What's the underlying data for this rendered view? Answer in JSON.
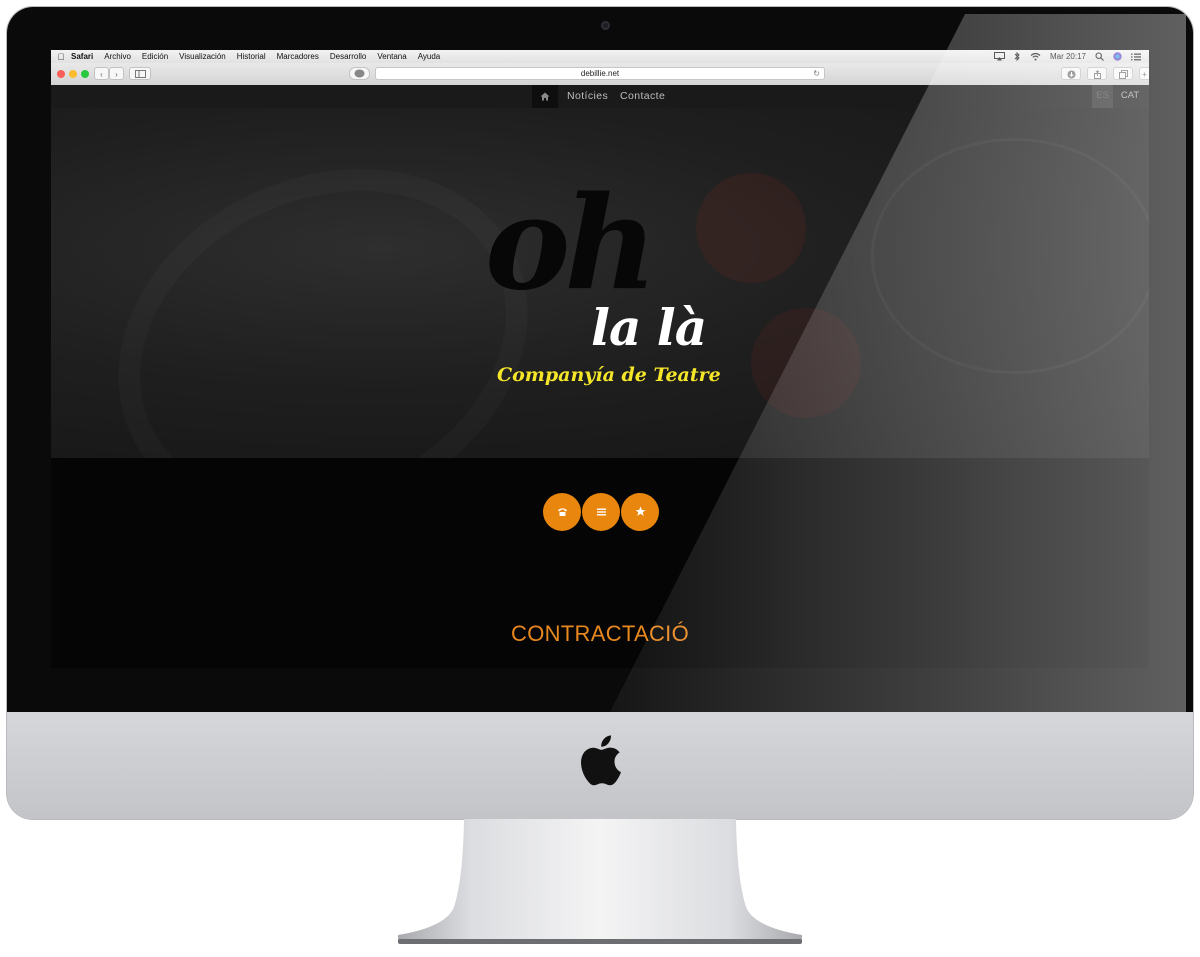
{
  "menubar": {
    "apple_icon": "apple-icon",
    "items": [
      "Safari",
      "Archivo",
      "Edición",
      "Visualización",
      "Historial",
      "Marcadores",
      "Desarrollo",
      "Ventana",
      "Ayuda"
    ],
    "clock": "Mar 20:17"
  },
  "browser": {
    "url": "debillie.net"
  },
  "site_nav": {
    "links": [
      "Notícies",
      "Contacte"
    ],
    "languages": [
      "ES",
      "CAT"
    ]
  },
  "hero": {
    "oh": "oh",
    "lala": "la là",
    "tagline": "Companyía de Teatre"
  },
  "actions": {
    "icons": [
      "phone-icon",
      "menu-icon",
      "star-icon"
    ],
    "color": "#e8860e"
  },
  "section_title": "CONTRACTACIÓ",
  "colors": {
    "accent": "#e8881f",
    "tagline": "#f5e62a"
  }
}
